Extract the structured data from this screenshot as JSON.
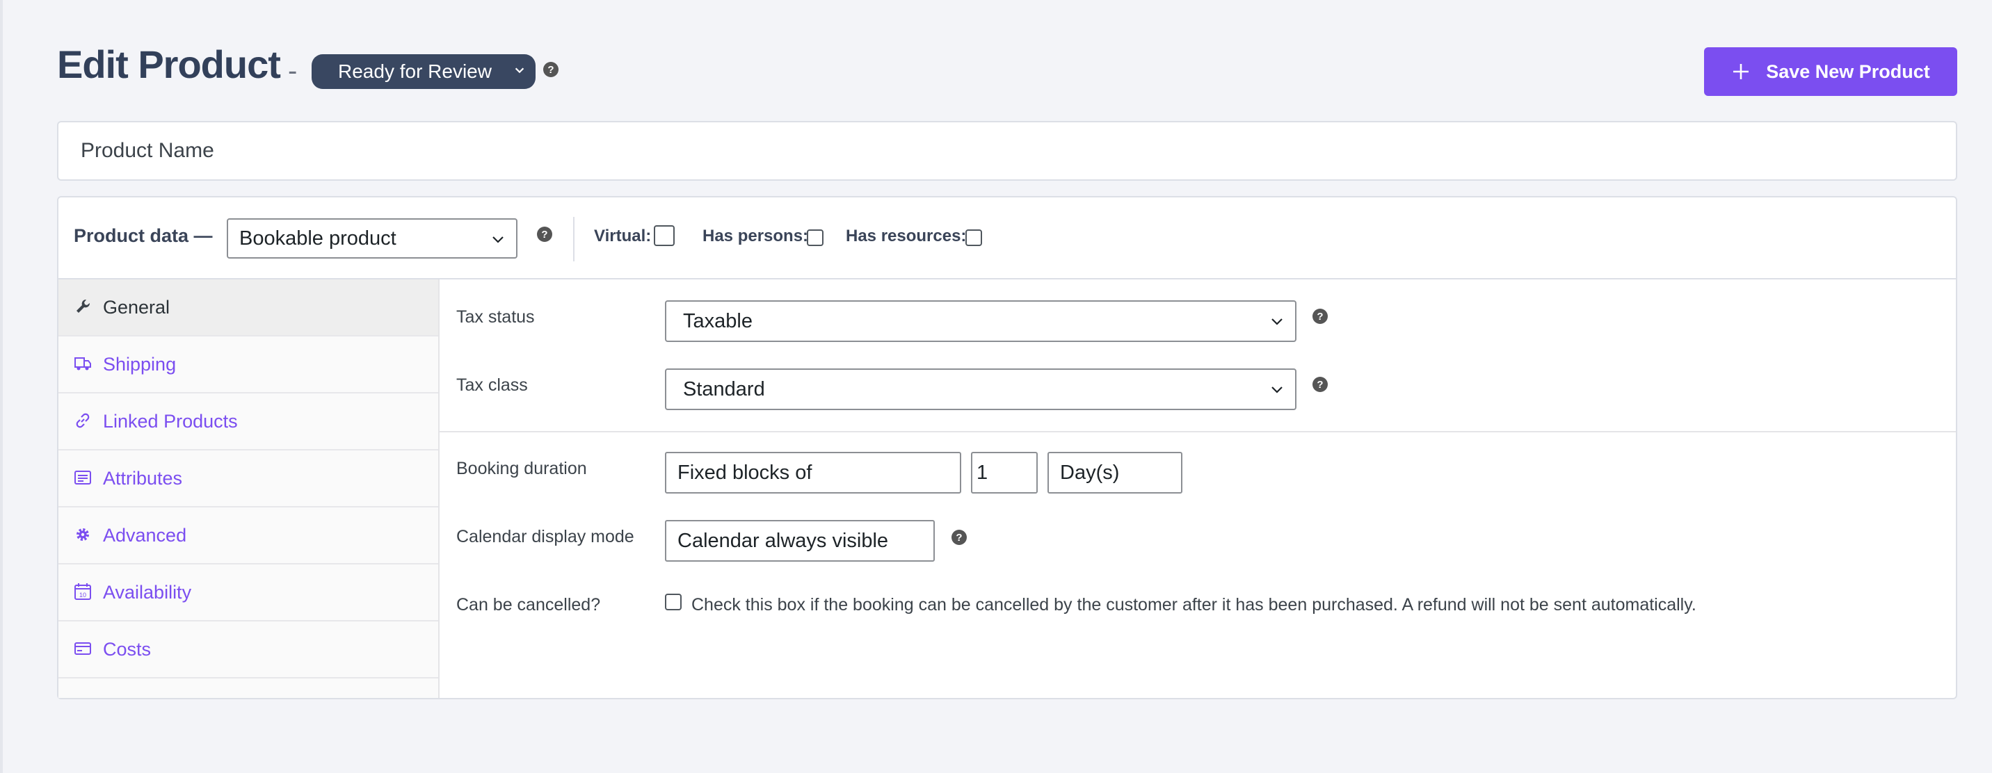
{
  "header": {
    "title": "Edit Product",
    "separator": "-",
    "status": "Ready for Review",
    "help": "?",
    "save_button": "Save New Product"
  },
  "product_name": {
    "placeholder": "Product Name"
  },
  "product_data": {
    "label": "Product data —",
    "type": "Bookable product",
    "help": "?",
    "options": [
      {
        "label": "Virtual:",
        "checked": false
      },
      {
        "label": "Has persons:",
        "checked": false
      },
      {
        "label": "Has resources:",
        "checked": false
      }
    ]
  },
  "tabs": [
    {
      "label": "General",
      "icon": "wrench-icon",
      "active": true
    },
    {
      "label": "Shipping",
      "icon": "truck-icon",
      "active": false
    },
    {
      "label": "Linked Products",
      "icon": "link-icon",
      "active": false
    },
    {
      "label": "Attributes",
      "icon": "list-icon",
      "active": false
    },
    {
      "label": "Advanced",
      "icon": "gear-icon",
      "active": false
    },
    {
      "label": "Availability",
      "icon": "calendar-icon",
      "active": false
    },
    {
      "label": "Costs",
      "icon": "card-icon",
      "active": false
    }
  ],
  "fields": {
    "tax_status": {
      "label": "Tax status",
      "value": "Taxable"
    },
    "tax_class": {
      "label": "Tax class",
      "value": "Standard"
    },
    "booking_duration": {
      "label": "Booking duration",
      "type": "Fixed blocks of",
      "amount": "1",
      "unit": "Day(s)"
    },
    "calendar_display": {
      "label": "Calendar display mode",
      "value": "Calendar always visible"
    },
    "can_cancel": {
      "label": "Can be cancelled?",
      "description": "Check this box if the booking can be cancelled by the customer after it has been purchased. A refund will not be sent automatically.",
      "checked": false
    }
  },
  "colors": {
    "accent": "#7b4ef0",
    "status_pill": "#394761",
    "title": "#32405a"
  }
}
